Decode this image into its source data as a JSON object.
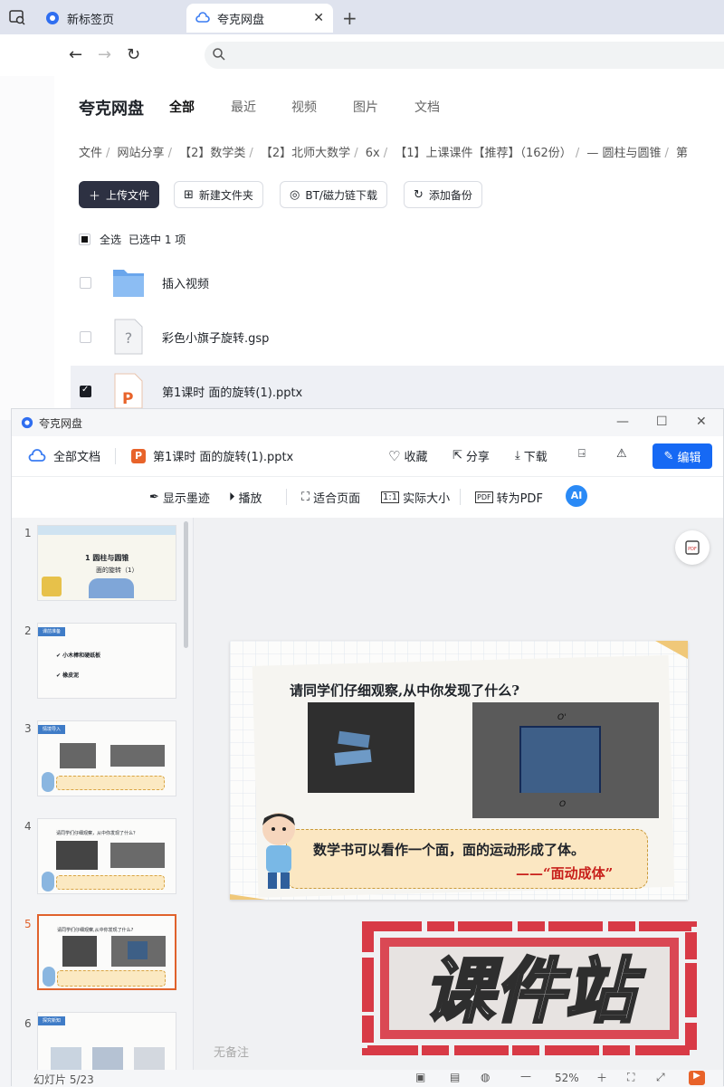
{
  "browser": {
    "tabs": [
      {
        "label": "新标签页",
        "active": false
      },
      {
        "label": "夸克网盘",
        "active": true
      }
    ],
    "new_tab": "+",
    "close": "✕"
  },
  "drive": {
    "brand": "夸克网盘",
    "nav": [
      "全部",
      "最近",
      "视频",
      "图片",
      "文档"
    ],
    "breadcrumb": [
      "文件",
      "网站分享",
      "【2】数学类",
      "【2】北师大数学",
      "6x",
      "【1】上课课件【推荐】（162份）",
      "— 圆柱与圆锥",
      "第"
    ],
    "buttons": {
      "upload": "上传文件",
      "new_folder": "新建文件夹",
      "bt": "BT/磁力链下载",
      "backup": "添加备份"
    },
    "select_all": "全选",
    "selected_info": "已选中  1  项",
    "files": [
      {
        "name": "插入视频",
        "type": "folder",
        "checked": false
      },
      {
        "name": "彩色小旗子旋转.gsp",
        "type": "unknown",
        "checked": false
      },
      {
        "name": "第1课时 面的旋转(1).pptx",
        "type": "pptx",
        "checked": true
      }
    ]
  },
  "viewer": {
    "window_title": "夸克网盘",
    "all_docs": "全部文档",
    "file_name": "第1课时 面的旋转(1).pptx",
    "actions": {
      "collect": "收藏",
      "share": "分享",
      "download": "下载",
      "edit": "编辑"
    },
    "toolbar": {
      "ink": "显示墨迹",
      "play": "播放",
      "fit": "适合页面",
      "actual": "实际大小",
      "to_pdf": "转为PDF"
    },
    "thumbs": [
      "1",
      "2",
      "3",
      "4",
      "5",
      "6"
    ],
    "thumb_texts": {
      "t1_title": "1  圆柱与圆锥",
      "t1_sub": "面的旋转（1）",
      "t2_tag": "课前准备",
      "t2_line1": "✔ 小木棒和硬纸板",
      "t2_line2": "✔ 橡皮泥",
      "t3_tag": "情境导入",
      "t4_text": "请同学们仔细观察，从中你发现了什么？",
      "t6_tag": "探究新知"
    },
    "active_thumb": 5,
    "slide": {
      "question": "请同学们仔细观察,从中你发现了什么?",
      "label_top": "O'",
      "label_bottom": "O",
      "statement": "数学书可以看作一个面，面的运动形成了体。",
      "quote": "——“面动成体”"
    },
    "notes": "无备注",
    "status": {
      "slide_count": "幻灯片 5/23",
      "zoom": "52%"
    }
  },
  "watermark": "课件站",
  "colors": {
    "accent": "#1669f4",
    "dark_button": "#2d3142",
    "active_thumb": "#e0622c",
    "quote_red": "#c8201b",
    "watermark_red": "#d83a46"
  }
}
